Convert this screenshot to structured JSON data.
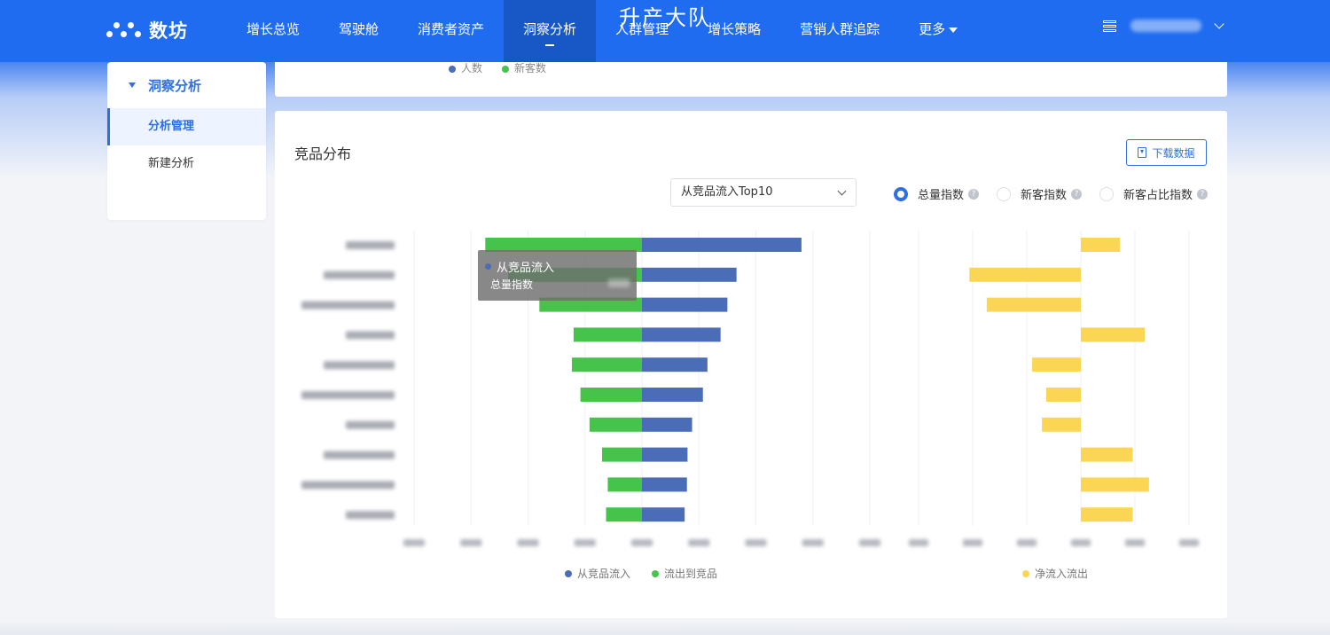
{
  "app": {
    "name": "数坊",
    "watermark": "升产大队"
  },
  "nav": {
    "items": [
      {
        "label": "增长总览"
      },
      {
        "label": "驾驶舱"
      },
      {
        "label": "消费者资产"
      },
      {
        "label": "洞察分析"
      },
      {
        "label": "人群管理"
      },
      {
        "label": "增长策略"
      },
      {
        "label": "营销人群追踪"
      },
      {
        "label": "更多"
      }
    ],
    "active": "洞察分析"
  },
  "sidebar": {
    "section": "洞察分析",
    "items": [
      {
        "label": "分析管理"
      },
      {
        "label": "新建分析"
      }
    ]
  },
  "top_legend": {
    "items": [
      {
        "label": "人数",
        "color": "#4b6cb7"
      },
      {
        "label": "新客数",
        "color": "#45c34a"
      }
    ]
  },
  "section": {
    "title": "竞品分布",
    "download_label": "下载数据",
    "select_value": "从竞品流入Top10",
    "radios": [
      {
        "label": "总量指数",
        "checked": true
      },
      {
        "label": "新客指数",
        "checked": false
      },
      {
        "label": "新客占比指数",
        "checked": false
      }
    ]
  },
  "tooltip": {
    "title": "从竞品流入",
    "metric": "总量指数"
  },
  "legend": {
    "left": [
      {
        "label": "从竞品流入",
        "color": "#4b6cb7"
      },
      {
        "label": "流出到竞品",
        "color": "#45c34a"
      }
    ],
    "right": [
      {
        "label": "净流入流出",
        "color": "#fbd655"
      }
    ]
  },
  "chart_data": [
    {
      "type": "bar",
      "orientation": "horizontal",
      "stacking": "diverging",
      "categories": [
        "",
        "",
        "",
        "",
        "",
        "",
        "",
        "",
        "",
        ""
      ],
      "series": [
        {
          "name": "从竞品流入",
          "color": "#4b6cb7",
          "values": [
            2.8,
            1.66,
            1.5,
            1.38,
            1.15,
            1.07,
            0.88,
            0.8,
            0.79,
            0.75
          ]
        },
        {
          "name": "流出到竞品",
          "color": "#45c34a",
          "values": [
            -2.75,
            -2.35,
            -1.8,
            -1.2,
            -1.23,
            -1.08,
            -0.92,
            -0.7,
            -0.6,
            -0.63
          ]
        }
      ],
      "xlim": [
        -4,
        4
      ],
      "grid": true
    },
    {
      "type": "bar",
      "orientation": "horizontal",
      "categories": [
        "",
        "",
        "",
        "",
        "",
        "",
        "",
        "",
        "",
        ""
      ],
      "series": [
        {
          "name": "净流入流出",
          "color": "#fbd655",
          "values": [
            0.36,
            -1.03,
            -0.87,
            0.59,
            -0.45,
            -0.32,
            -0.36,
            0.48,
            0.63,
            0.48
          ]
        }
      ],
      "xlim": [
        -1.5,
        1
      ],
      "grid": true
    }
  ]
}
